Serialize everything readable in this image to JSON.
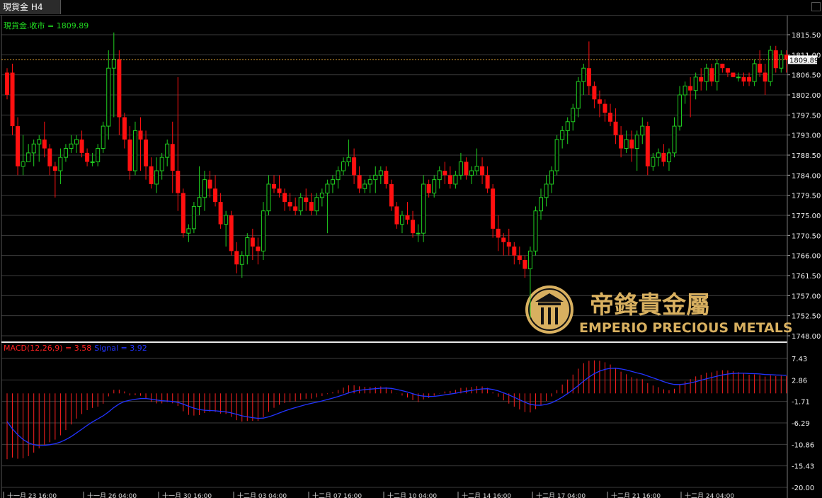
{
  "tab": {
    "title": "現貨金 H4"
  },
  "colors": {
    "up": "#20d020",
    "down": "#ff1010",
    "grid": "#3c3c3c",
    "price_line": "#e0a030",
    "macd_hist": "#ff2020",
    "signal": "#2233ff",
    "brand": "#d8b060"
  },
  "main_label": "現貨金.收市 = 1809.89",
  "current_price": "1809.89",
  "macd_label": {
    "macd": "MACD(12,26,9) = 3.58",
    "signal": "Signal = 3.92"
  },
  "watermark": {
    "en": "EMPERIO PRECIOUS METALS",
    "cn": "帝鋒貴金屬"
  },
  "x_labels": [
    "十一月 23 16:00",
    "十一月 26 04:00",
    "十一月 30 16:00",
    "十二月 03 04:00",
    "十二月 07 16:00",
    "十二月 10 04:00",
    "十二月 14 16:00",
    "十二月 17 04:00",
    "十二月 21 16:00",
    "十二月 24 04:00"
  ],
  "chart_data": [
    {
      "type": "candlestick",
      "title": "現貨金 H4",
      "ylim": [
        1748.0,
        1817.5
      ],
      "yticks": [
        "1815.50",
        "1811.00",
        "1806.50",
        "1802.00",
        "1797.50",
        "1793.00",
        "1788.50",
        "1784.00",
        "1779.50",
        "1775.00",
        "1770.50",
        "1766.00",
        "1761.50",
        "1757.00",
        "1752.50",
        "1748.00"
      ],
      "last_close": 1809.89,
      "candles": [
        [
          1807,
          1808,
          1801,
          1802
        ],
        [
          1807,
          1809,
          1793,
          1795
        ],
        [
          1795,
          1797,
          1784,
          1786
        ],
        [
          1786,
          1793,
          1784,
          1787
        ],
        [
          1787,
          1791,
          1787,
          1789
        ],
        [
          1789,
          1792,
          1786,
          1791
        ],
        [
          1791,
          1793,
          1787,
          1792
        ],
        [
          1792,
          1796,
          1788,
          1790
        ],
        [
          1790,
          1791,
          1784,
          1786
        ],
        [
          1786,
          1787,
          1779,
          1785
        ],
        [
          1785,
          1790,
          1782,
          1788
        ],
        [
          1788,
          1791,
          1787,
          1790
        ],
        [
          1790,
          1793,
          1789,
          1791
        ],
        [
          1791,
          1793,
          1789,
          1792
        ],
        [
          1792,
          1794,
          1788,
          1789
        ],
        [
          1789,
          1790,
          1786,
          1787
        ],
        [
          1787,
          1789,
          1786,
          1787
        ],
        [
          1787,
          1791,
          1786,
          1790
        ],
        [
          1790,
          1796,
          1789,
          1795
        ],
        [
          1795,
          1812,
          1792,
          1808
        ],
        [
          1808,
          1816,
          1797,
          1810
        ],
        [
          1810,
          1812,
          1793,
          1797
        ],
        [
          1797,
          1798,
          1790,
          1792
        ],
        [
          1792,
          1795,
          1783,
          1785
        ],
        [
          1785,
          1796,
          1784,
          1794
        ],
        [
          1794,
          1797,
          1785,
          1792
        ],
        [
          1792,
          1794,
          1783,
          1786
        ],
        [
          1786,
          1788,
          1781,
          1782
        ],
        [
          1782,
          1788,
          1780,
          1785
        ],
        [
          1785,
          1789,
          1783,
          1788
        ],
        [
          1788,
          1792,
          1786,
          1791
        ],
        [
          1791,
          1796,
          1780,
          1785
        ],
        [
          1785,
          1806,
          1776,
          1780
        ],
        [
          1780,
          1781,
          1770,
          1771
        ],
        [
          1771,
          1773,
          1769,
          1772
        ],
        [
          1772,
          1778,
          1771,
          1777
        ],
        [
          1777,
          1786,
          1775,
          1779
        ],
        [
          1779,
          1785,
          1776,
          1783
        ],
        [
          1783,
          1785,
          1779,
          1781
        ],
        [
          1781,
          1784,
          1777,
          1778
        ],
        [
          1778,
          1780,
          1772,
          1773
        ],
        [
          1773,
          1776,
          1768,
          1775
        ],
        [
          1775,
          1776,
          1766,
          1767
        ],
        [
          1767,
          1769,
          1762,
          1764
        ],
        [
          1764,
          1767,
          1761,
          1766
        ],
        [
          1766,
          1771,
          1764,
          1770
        ],
        [
          1770,
          1772,
          1765,
          1768
        ],
        [
          1768,
          1770,
          1764,
          1767
        ],
        [
          1767,
          1778,
          1765,
          1776
        ],
        [
          1776,
          1784,
          1775,
          1782
        ],
        [
          1782,
          1784,
          1780,
          1781
        ],
        [
          1781,
          1784,
          1779,
          1780
        ],
        [
          1780,
          1781,
          1776,
          1778
        ],
        [
          1778,
          1780,
          1776,
          1777
        ],
        [
          1777,
          1779,
          1775,
          1776
        ],
        [
          1776,
          1780,
          1775,
          1779
        ],
        [
          1779,
          1781,
          1776,
          1778
        ],
        [
          1778,
          1780,
          1775,
          1776
        ],
        [
          1776,
          1780,
          1775,
          1779
        ],
        [
          1779,
          1781,
          1777,
          1780
        ],
        [
          1780,
          1783,
          1771,
          1782
        ],
        [
          1782,
          1784,
          1780,
          1783
        ],
        [
          1783,
          1786,
          1781,
          1785
        ],
        [
          1785,
          1788,
          1784,
          1787
        ],
        [
          1787,
          1792,
          1786,
          1788
        ],
        [
          1788,
          1790,
          1782,
          1784
        ],
        [
          1784,
          1786,
          1780,
          1781
        ],
        [
          1781,
          1783,
          1780,
          1782
        ],
        [
          1782,
          1784,
          1780,
          1783
        ],
        [
          1783,
          1786,
          1780,
          1784
        ],
        [
          1784,
          1786,
          1782,
          1785
        ],
        [
          1785,
          1786,
          1781,
          1782
        ],
        [
          1782,
          1783,
          1776,
          1777
        ],
        [
          1777,
          1778,
          1772,
          1773
        ],
        [
          1773,
          1776,
          1771,
          1775
        ],
        [
          1775,
          1778,
          1773,
          1774
        ],
        [
          1774,
          1776,
          1770,
          1771
        ],
        [
          1771,
          1773,
          1769,
          1771
        ],
        [
          1771,
          1784,
          1769,
          1782
        ],
        [
          1782,
          1783,
          1779,
          1780
        ],
        [
          1780,
          1784,
          1779,
          1783
        ],
        [
          1783,
          1786,
          1781,
          1785
        ],
        [
          1785,
          1787,
          1782,
          1784
        ],
        [
          1784,
          1786,
          1781,
          1782
        ],
        [
          1782,
          1785,
          1781,
          1784
        ],
        [
          1784,
          1789,
          1783,
          1787
        ],
        [
          1787,
          1788,
          1783,
          1784
        ],
        [
          1784,
          1786,
          1782,
          1785
        ],
        [
          1785,
          1790,
          1784,
          1786
        ],
        [
          1786,
          1788,
          1782,
          1784
        ],
        [
          1784,
          1786,
          1780,
          1781
        ],
        [
          1781,
          1782,
          1770,
          1772
        ],
        [
          1772,
          1775,
          1767,
          1770
        ],
        [
          1770,
          1771,
          1766,
          1769
        ],
        [
          1769,
          1772,
          1766,
          1768
        ],
        [
          1768,
          1769,
          1764,
          1766
        ],
        [
          1766,
          1768,
          1764,
          1765
        ],
        [
          1765,
          1766,
          1761,
          1763
        ],
        [
          1763,
          1768,
          1752,
          1767
        ],
        [
          1767,
          1777,
          1766,
          1776
        ],
        [
          1776,
          1781,
          1774,
          1779
        ],
        [
          1779,
          1784,
          1777,
          1782
        ],
        [
          1782,
          1786,
          1780,
          1785
        ],
        [
          1785,
          1793,
          1784,
          1792
        ],
        [
          1792,
          1795,
          1790,
          1794
        ],
        [
          1794,
          1797,
          1791,
          1796
        ],
        [
          1796,
          1800,
          1794,
          1799
        ],
        [
          1799,
          1806,
          1797,
          1805
        ],
        [
          1805,
          1809,
          1802,
          1808
        ],
        [
          1808,
          1814,
          1802,
          1804
        ],
        [
          1804,
          1805,
          1799,
          1801
        ],
        [
          1801,
          1803,
          1797,
          1800
        ],
        [
          1800,
          1801,
          1796,
          1798
        ],
        [
          1798,
          1800,
          1795,
          1796
        ],
        [
          1796,
          1799,
          1791,
          1793
        ],
        [
          1793,
          1795,
          1788,
          1790
        ],
        [
          1790,
          1794,
          1789,
          1792
        ],
        [
          1792,
          1794,
          1787,
          1790
        ],
        [
          1790,
          1794,
          1785,
          1793
        ],
        [
          1793,
          1797,
          1791,
          1795
        ],
        [
          1795,
          1796,
          1784,
          1786
        ],
        [
          1786,
          1789,
          1785,
          1788
        ],
        [
          1788,
          1790,
          1786,
          1789
        ],
        [
          1789,
          1791,
          1786,
          1787
        ],
        [
          1787,
          1790,
          1785,
          1789
        ],
        [
          1789,
          1797,
          1788,
          1795
        ],
        [
          1795,
          1804,
          1794,
          1802
        ],
        [
          1802,
          1805,
          1800,
          1804
        ],
        [
          1804,
          1806,
          1797,
          1803
        ],
        [
          1803,
          1807,
          1801,
          1806
        ],
        [
          1806,
          1808,
          1803,
          1805
        ],
        [
          1805,
          1809,
          1803,
          1808
        ],
        [
          1808,
          1809,
          1804,
          1805
        ],
        [
          1805,
          1810,
          1803,
          1809
        ],
        [
          1809,
          1809,
          1807,
          1808
        ],
        [
          1808,
          1808,
          1806,
          1807
        ],
        [
          1807,
          1807,
          1806,
          1806
        ],
        [
          1806,
          1807,
          1805,
          1806
        ],
        [
          1806,
          1807,
          1804,
          1805
        ],
        [
          1806,
          1807,
          1804,
          1805
        ],
        [
          1805,
          1810,
          1804,
          1809
        ],
        [
          1809,
          1812,
          1806,
          1807
        ],
        [
          1807,
          1809,
          1802,
          1805
        ],
        [
          1805,
          1813,
          1804,
          1812
        ],
        [
          1812,
          1813,
          1807,
          1808
        ],
        [
          1808,
          1812,
          1807,
          1811
        ],
        [
          1811,
          1812,
          1807,
          1809.89
        ]
      ]
    },
    {
      "type": "macd",
      "title": "MACD(12,26,9)",
      "ylim": [
        -20.0,
        10.0
      ],
      "yticks": [
        "7.43",
        "2.86",
        "-1.71",
        "-6.29",
        "-10.86",
        "-15.43",
        "-20.00"
      ],
      "macd": 3.58,
      "signal": 3.92
    }
  ]
}
